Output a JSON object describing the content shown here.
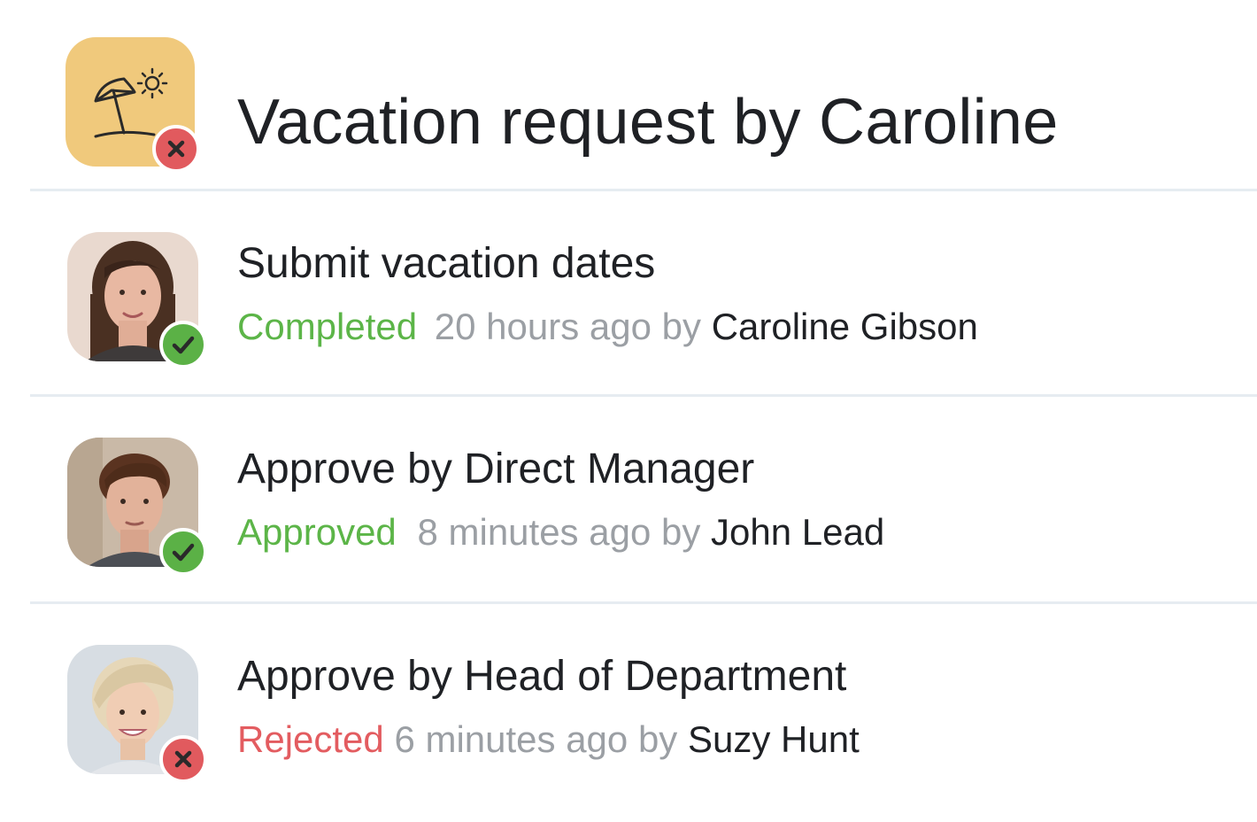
{
  "header": {
    "title": "Vacation request by Caroline",
    "icon": "beach-umbrella-icon",
    "badge": "reject-x-icon",
    "icon_background": "#f0c97c"
  },
  "colors": {
    "completed": "#5cb548",
    "rejected": "#e35c60",
    "muted": "#9b9fa4",
    "text": "#1f2125",
    "divider": "#e6ecf1"
  },
  "steps": [
    {
      "title": "Submit vacation dates",
      "status": "Completed",
      "time": "20 hours ago",
      "by": "by",
      "actor": "Caroline Gibson",
      "badge": "check-icon"
    },
    {
      "title": "Approve by Direct Manager",
      "status": "Approved",
      "time": "8 minutes ago",
      "by": "by",
      "actor": "John Lead",
      "badge": "check-icon"
    },
    {
      "title": "Approve by Head of Department",
      "status": "Rejected",
      "time": "6 minutes ago",
      "by": "by",
      "actor": "Suzy Hunt",
      "badge": "x-icon"
    }
  ]
}
